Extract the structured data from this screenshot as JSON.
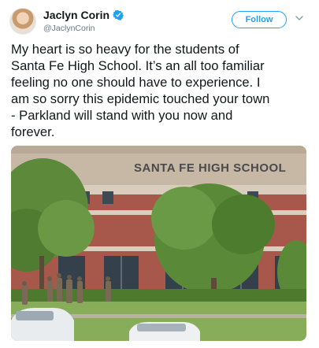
{
  "tweet": {
    "display_name": "Jaclyn Corin",
    "handle": "@JaclynCorin",
    "follow_label": "Follow",
    "text": "My heart is so heavy for the students of\nSanta Fe High School. It’s an all too familiar\nfeeling no one should have to experience. I\nam so sorry this epidemic touched your town\n- Parkland will stand with you now and\nforever.",
    "photo_sign_text": "SANTA FE HIGH SCHOOL"
  },
  "icons": {
    "verified": "verified-badge-icon",
    "caret": "chevron-down-icon"
  },
  "colors": {
    "accent": "#1da1f2",
    "text": "#14171a",
    "secondary": "#657786"
  }
}
